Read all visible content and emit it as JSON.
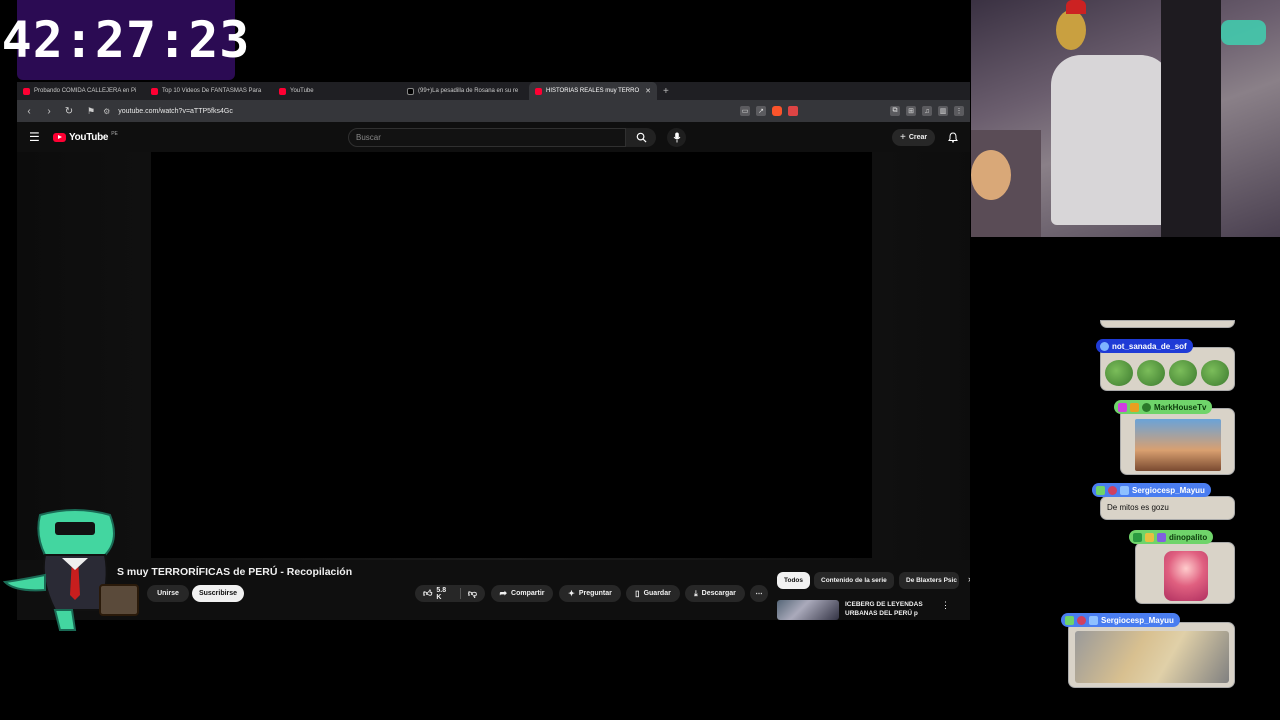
{
  "timer": "42:27:23",
  "browser": {
    "tabs": [
      {
        "label": "Probando COMIDA CALLEJERA en Pi",
        "icon": "youtube-icon",
        "active": false
      },
      {
        "label": "Top 10 Videos De FANTASMAS Para",
        "icon": "youtube-icon",
        "active": false
      },
      {
        "label": "YouTube",
        "icon": "youtube-icon",
        "active": false
      },
      {
        "label": "(99+)La pesadilla de Rosana en su re",
        "icon": "tiktok-icon",
        "active": false
      },
      {
        "label": "HISTORIAS REALES muy TERRO",
        "icon": "youtube-icon",
        "active": true
      }
    ],
    "url": "youtube.com/watch?v=aTTP5fks4Gc"
  },
  "youtube": {
    "logo_text": "YouTube",
    "logo_region": "PE",
    "search_placeholder": "Buscar",
    "create_label": "Crear",
    "video_title": "S muy TERRORÍFICAS de PERÚ - Recopilación",
    "join_label": "Unirse",
    "subscribe_label": "Suscribirse",
    "likes": "5.8 K",
    "share_label": "Compartir",
    "ask_label": "Preguntar",
    "save_label": "Guardar",
    "download_label": "Descargar",
    "chips": [
      "Todos",
      "Contenido de la serie",
      "De Blaxters Psic"
    ],
    "recommendation_title": "ICEBERG DE LEYENDAS URBANAS DEL PERÚ p"
  },
  "chat": {
    "messages": [
      {
        "user": "not_sanada_de_sof",
        "color": "#1f3bd6",
        "text_color": "#ffffff"
      },
      {
        "user": "MarkHouseTv",
        "color": "#6fd46a",
        "text_color": "#0b3b0b"
      },
      {
        "user": "Sergiocesp_Mayuu",
        "color": "#4a7df0",
        "text_color": "#ffffff",
        "text": "De mitos es gozu"
      },
      {
        "user": "dinopalito",
        "color": "#6fd46a",
        "text_color": "#0b3b0b"
      },
      {
        "user": "Sergiocesp_Mayuu",
        "color": "#4a7df0",
        "text_color": "#ffffff"
      }
    ]
  },
  "colors": {
    "youtube_red": "#ff0033",
    "timer_bg": "#2b0b53"
  }
}
